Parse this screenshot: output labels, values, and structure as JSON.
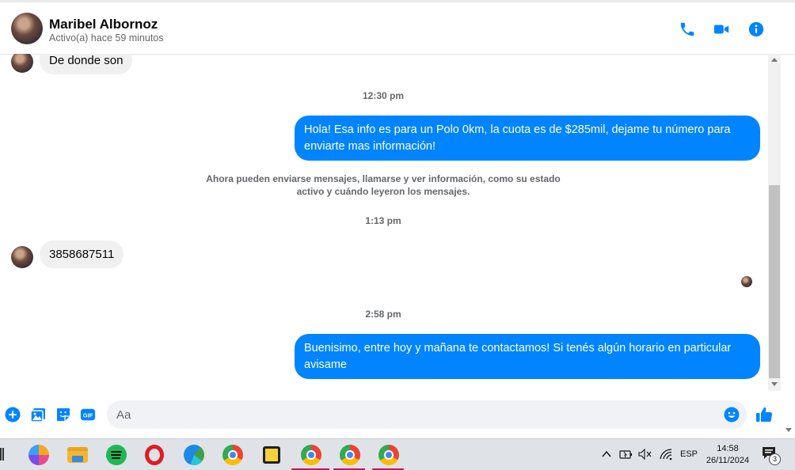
{
  "header": {
    "name": "Maribel Albornoz",
    "status": "Activo(a) hace 59 minutos"
  },
  "messages": {
    "m1": "De donde son",
    "t1": "12:30 pm",
    "m2": "Hola! Esa info es para un Polo 0km, la cuota es de $285mil, dejame tu número para enviarte mas información!",
    "sys": "Ahora pueden enviarse mensajes, llamarse y ver información, como su estado activo y cuándo leyeron los mensajes.",
    "t2": "1:13 pm",
    "m3": "3858687511",
    "t3": "2:58 pm",
    "m4": "Buenisimo, entre hoy y mañana te contactamos! Si tenés algún horario en particular avisame"
  },
  "composer": {
    "placeholder": "Aa"
  },
  "taskbar": {
    "lang": "ESP",
    "time": "14:58",
    "date": "26/11/2024",
    "notif_count": "3"
  },
  "colors": {
    "accent": "#0084ff",
    "incoming_bubble": "#f0f0f0"
  }
}
